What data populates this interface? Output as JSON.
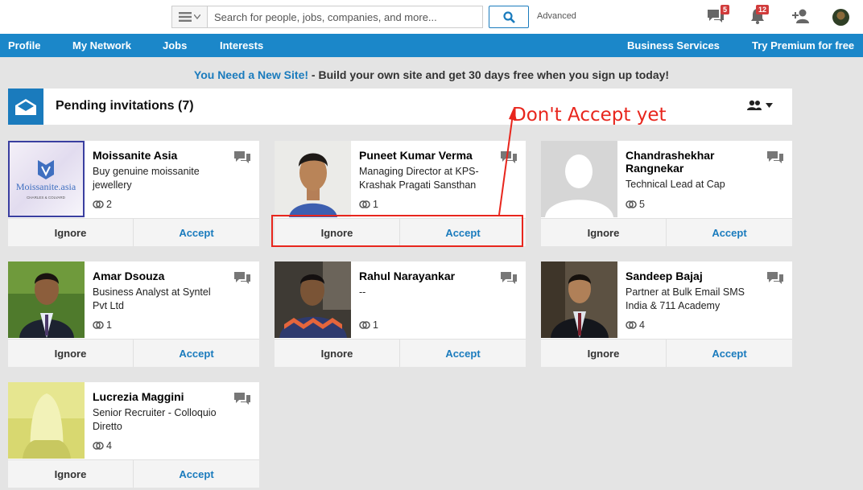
{
  "search": {
    "placeholder": "Search for people, jobs, companies, and more...",
    "advanced_label": "Advanced"
  },
  "top_icons": {
    "messages_count": "5",
    "notifications_count": "12"
  },
  "nav": {
    "left": [
      "Profile",
      "My Network",
      "Jobs",
      "Interests"
    ],
    "right": [
      "Business Services",
      "Try Premium for free"
    ]
  },
  "promo": {
    "link": "You Need a New Site!",
    "text": " - Build your own site and get 30 days free when you sign up today!"
  },
  "pending": {
    "title": "Pending invitations (7)"
  },
  "annotation": {
    "text": "Don't Accept yet"
  },
  "actions": {
    "ignore": "Ignore",
    "accept": "Accept"
  },
  "logo": {
    "text": "Moissanite.asia",
    "subtext": "CHARLES & COLVARD"
  },
  "cards": [
    {
      "name": "Moissanite Asia",
      "headline": "Buy genuine moissanite jewellery",
      "connections": "2"
    },
    {
      "name": "Puneet Kumar Verma",
      "headline": "Managing Director at KPS-Krashak Pragati Sansthan",
      "connections": "1"
    },
    {
      "name": "Chandrashekhar Rangnekar",
      "headline": "Technical Lead at Cap",
      "connections": "5"
    },
    {
      "name": "Amar Dsouza",
      "headline": "Business Analyst at Syntel Pvt Ltd",
      "connections": "1"
    },
    {
      "name": "Rahul Narayankar",
      "headline": "--",
      "connections": "1"
    },
    {
      "name": "Sandeep Bajaj",
      "headline": "Partner at Bulk Email SMS India & 711 Academy",
      "connections": "4"
    },
    {
      "name": "Lucrezia Maggini",
      "headline": "Senior Recruiter - Colloquio Diretto",
      "connections": "4"
    }
  ]
}
